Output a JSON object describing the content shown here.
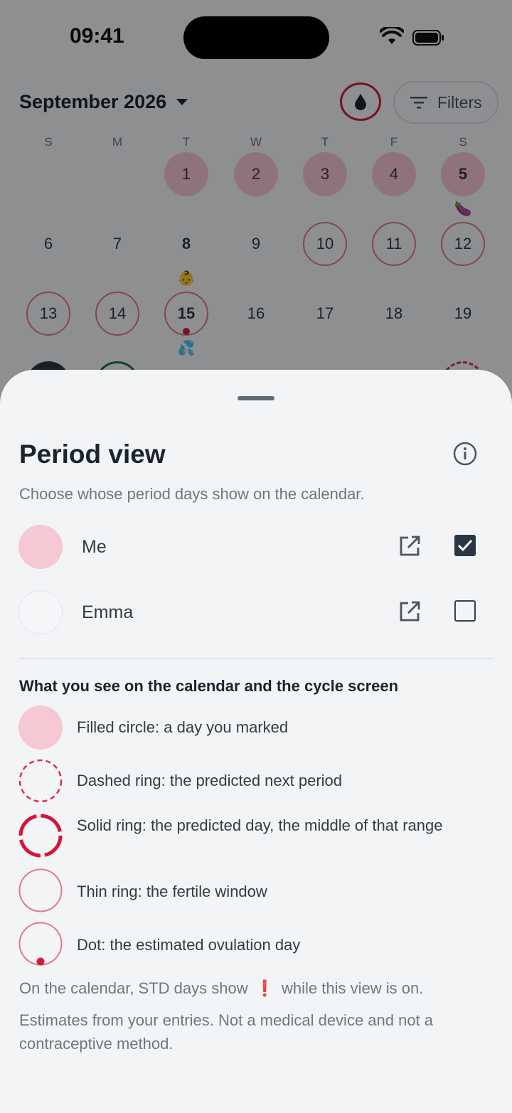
{
  "status_bar": {
    "time": "09:41"
  },
  "header": {
    "month": "September 2026",
    "filters_label": "Filters"
  },
  "calendar": {
    "weekdays": [
      "S",
      "M",
      "T",
      "W",
      "T",
      "F",
      "S"
    ],
    "days": [
      "1",
      "2",
      "3",
      "4",
      "5",
      "6",
      "7",
      "8",
      "9",
      "10",
      "11",
      "12",
      "13",
      "14",
      "15",
      "16",
      "17",
      "18",
      "19"
    ],
    "emojis": {
      "5": "🍆",
      "8": "👶",
      "15": "💦"
    }
  },
  "colors": {
    "marked": "#f4c9d3",
    "fertile_ring": "#e07b8d",
    "accent": "#cc1f3b",
    "checkbox": "#2a3742"
  },
  "sheet": {
    "title": "Period view",
    "subtitle": "Choose whose period days show on the calendar.",
    "people": [
      {
        "name": "Me",
        "checked": true
      },
      {
        "name": "Emma",
        "checked": false
      }
    ],
    "legend_title": "What you see on the calendar and the cycle screen",
    "legend": [
      {
        "icon": "filled-circle-icon",
        "text": "Filled circle: a day you marked"
      },
      {
        "icon": "dashed-ring-icon",
        "text": "Dashed ring: the predicted next period"
      },
      {
        "icon": "solid-ring-icon",
        "text": "Solid ring: the predicted day, the middle of that range"
      },
      {
        "icon": "thin-ring-icon",
        "text": "Thin ring: the fertile window"
      },
      {
        "icon": "dot-icon",
        "text": "Dot: the estimated ovulation day"
      }
    ],
    "std_note_before": "On the calendar, STD days show",
    "std_note_mark": "❗",
    "std_note_after": "while this view is on.",
    "disclaimer": "Estimates from your entries. Not a medical device and not a contraceptive method."
  }
}
